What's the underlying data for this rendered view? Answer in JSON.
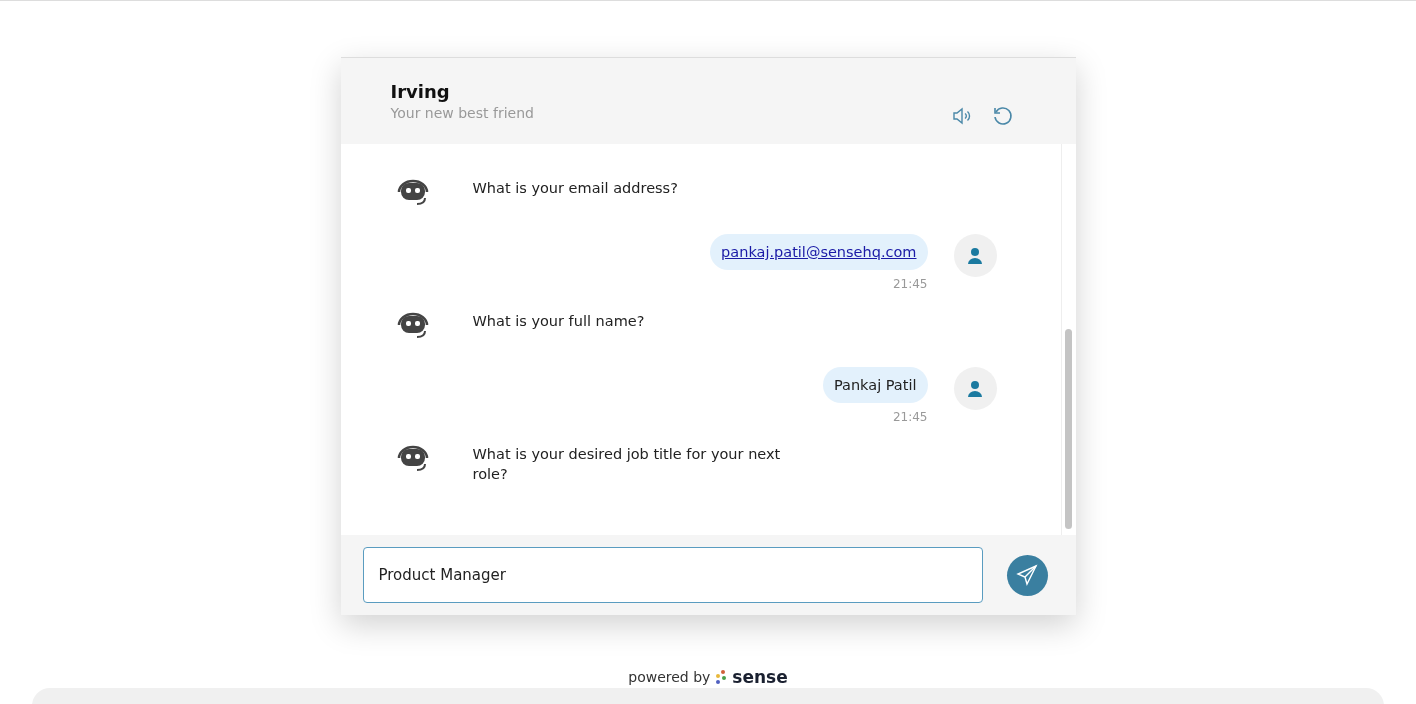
{
  "header": {
    "title": "Irving",
    "subtitle": "Your new best friend"
  },
  "messages": [
    {
      "kind": "bot",
      "text": "What is your email address?"
    },
    {
      "kind": "user",
      "text": "pankaj.patil@sensehq.com",
      "link": true,
      "time": "21:45"
    },
    {
      "kind": "bot",
      "text": "What is your full name?"
    },
    {
      "kind": "user",
      "text": "Pankaj Patil",
      "link": false,
      "time": "21:45"
    },
    {
      "kind": "bot",
      "text": "What is your desired job title for your next role?"
    }
  ],
  "input": {
    "value": "Product Manager"
  },
  "footer": {
    "prefix": "powered by",
    "brand": "sense"
  }
}
